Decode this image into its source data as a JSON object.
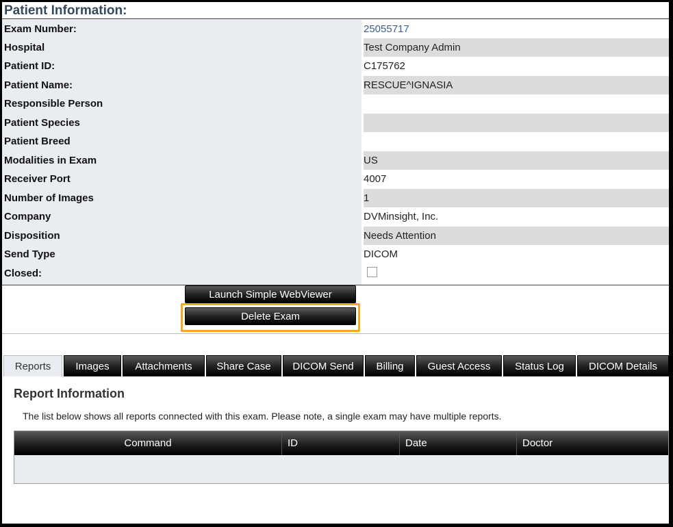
{
  "section_title": "Patient Information:",
  "rows": [
    {
      "label": "Exam Number:",
      "value": "25055717"
    },
    {
      "label": "Hospital",
      "value": "Test Company Admin"
    },
    {
      "label": "Patient ID:",
      "value": "C175762"
    },
    {
      "label": "Patient Name:",
      "value": "RESCUE^IGNASIA"
    },
    {
      "label": "Responsible Person",
      "value": ""
    },
    {
      "label": "Patient Species",
      "value": ""
    },
    {
      "label": "Patient Breed",
      "value": ""
    },
    {
      "label": "Modalities in Exam",
      "value": "US"
    },
    {
      "label": "Receiver Port",
      "value": "4007"
    },
    {
      "label": "Number of Images",
      "value": "1"
    },
    {
      "label": "Company",
      "value": "DVMinsight, Inc."
    },
    {
      "label": "Disposition",
      "value": "Needs Attention"
    },
    {
      "label": "Send Type",
      "value": "DICOM"
    },
    {
      "label": "Closed:",
      "value": ""
    }
  ],
  "closed_checked": false,
  "buttons": {
    "launch_viewer": "Launch Simple WebViewer",
    "delete_exam": "Delete Exam"
  },
  "tabs": [
    "Reports",
    "Images",
    "Attachments",
    "Share Case",
    "DICOM Send",
    "Billing",
    "Guest Access",
    "Status Log",
    "DICOM Details"
  ],
  "active_tab": "Reports",
  "report": {
    "title": "Report Information",
    "description": "The list below shows all reports connected with this exam.  Please note, a single exam may have multiple reports.",
    "columns": [
      "Command",
      "ID",
      "Date",
      "Doctor"
    ]
  },
  "colors": {
    "highlight": "#f5a623",
    "link": "#3b5f86",
    "title": "#34495e"
  }
}
